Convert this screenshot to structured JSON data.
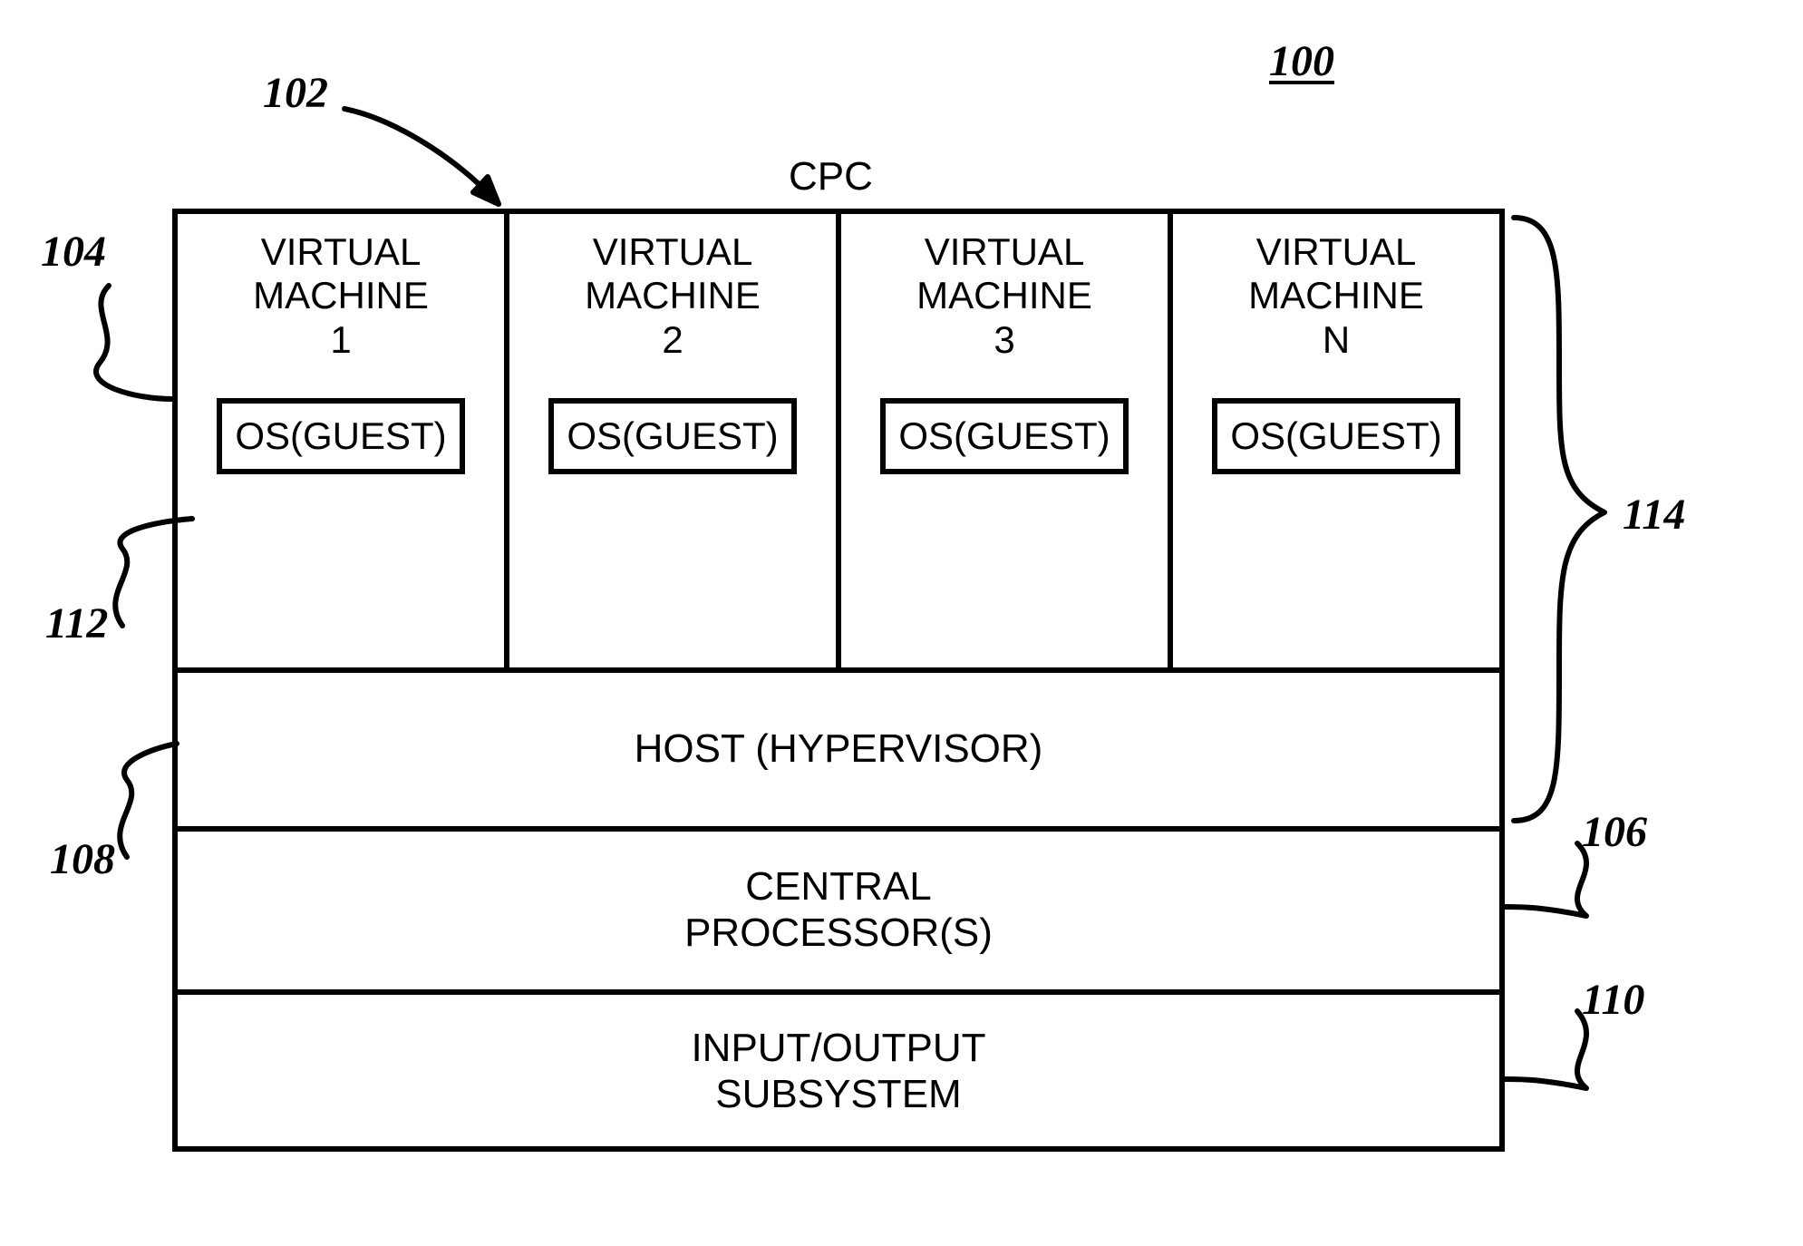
{
  "figure_number": "100",
  "title": "CPC",
  "callouts": {
    "c102": "102",
    "c104": "104",
    "c112": "112",
    "c108": "108",
    "c114": "114",
    "c106": "106",
    "c110": "110"
  },
  "vms": [
    {
      "title": "VIRTUAL\nMACHINE\n1",
      "os": "OS(GUEST)"
    },
    {
      "title": "VIRTUAL\nMACHINE\n2",
      "os": "OS(GUEST)"
    },
    {
      "title": "VIRTUAL\nMACHINE\n3",
      "os": "OS(GUEST)"
    },
    {
      "title": "VIRTUAL\nMACHINE\nN",
      "os": "OS(GUEST)"
    }
  ],
  "layers": {
    "host": "HOST (HYPERVISOR)",
    "cpu": "CENTRAL\nPROCESSOR(S)",
    "io": "INPUT/OUTPUT\nSUBSYSTEM"
  }
}
